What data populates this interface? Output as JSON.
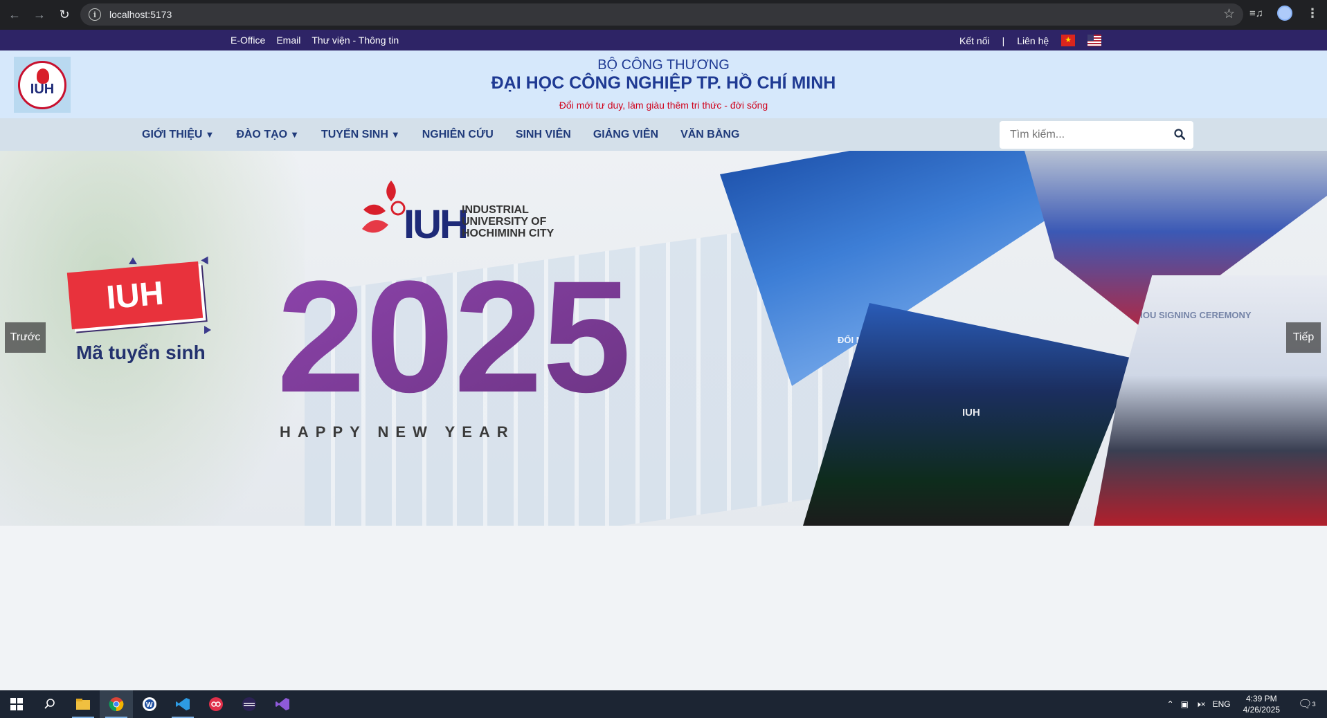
{
  "browser": {
    "url": "localhost:5173",
    "back_icon": "arrow-left-icon",
    "forward_icon": "arrow-right-icon",
    "reload_icon": "reload-icon"
  },
  "topbar": {
    "links": [
      "E-Office",
      "Email",
      "Thư viện - Thông tin"
    ],
    "connect": "Kết nối",
    "separator": "|",
    "contact": "Liên hệ"
  },
  "header": {
    "ministry": "BỘ CÔNG THƯƠNG",
    "university": "ĐẠI HỌC CÔNG NGHIỆP TP. HỒ CHÍ MINH",
    "slogan": "Đổi mới tư duy, làm giàu thêm tri thức - đời sống",
    "logo_text": "IUH"
  },
  "nav": {
    "items": [
      {
        "label": "GIỚI THIỆU",
        "caret": "▼"
      },
      {
        "label": "ĐÀO TẠO",
        "caret": "▼"
      },
      {
        "label": "TUYỂN SINH",
        "caret": "▼"
      },
      {
        "label": "NGHIÊN CỨU",
        "caret": ""
      },
      {
        "label": "SINH VIÊN",
        "caret": ""
      },
      {
        "label": "GIẢNG VIÊN",
        "caret": ""
      },
      {
        "label": "VĂN BẰNG",
        "caret": ""
      }
    ],
    "search_placeholder": "Tìm kiếm..."
  },
  "banner": {
    "badge": "IUH",
    "badge_caption": "Mã tuyển sinh",
    "logo_letters": "IUH",
    "logo_line1": "INDUSTRIAL",
    "logo_line2": "UNIVERSITY OF",
    "logo_line3": "HOCHIMINH CITY",
    "year": "2025",
    "greeting": "HAPPY NEW YEAR",
    "photo1_text": "ĐỔI MỚI · ĐOÀN KẾT",
    "photo3_text": "IUH",
    "photo4_text": "MOU SIGNING CEREMONY",
    "prev": "Trước",
    "next": "Tiếp"
  },
  "taskbar": {
    "lang": "ENG",
    "time": "4:39 PM",
    "date": "4/26/2025",
    "notif_count": "3"
  }
}
